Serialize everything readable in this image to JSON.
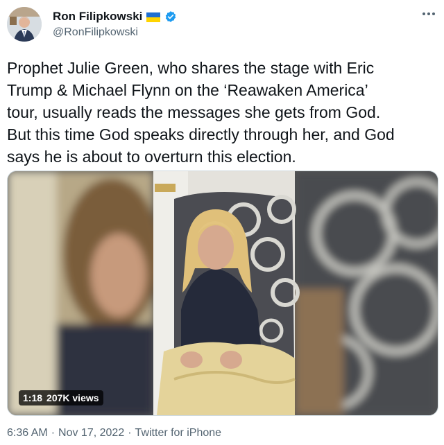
{
  "author": {
    "name": "Ron Filipkowski",
    "handle": "@RonFilipkowski",
    "flag_icon": "ukraine-flag-icon",
    "verified_icon": "verified-badge-icon",
    "verified_color": "#1d9bf0"
  },
  "tweet": {
    "text": "Prophet Julie Green, who shares the stage with Eric\nTrump & Michael Flynn on the ‘Reawaken America’\ntour, usually reads the messages she gets from God.\nBut this time God speaks directly through her, and God\nsays he is about to overturn this election."
  },
  "video": {
    "duration": "1:18",
    "views": "207K views"
  },
  "footer": {
    "time": "6:36 AM",
    "separator1": "·",
    "date": "Nov 17, 2022",
    "separator2": "·",
    "source": "Twitter for iPhone"
  }
}
